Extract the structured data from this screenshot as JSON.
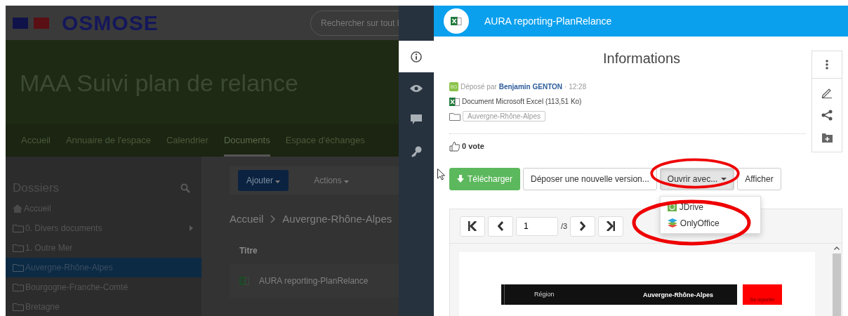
{
  "app": {
    "logo": "OSMOSE",
    "search": "Rechercher sur tout l"
  },
  "space_title": "MAA Suivi plan de relance",
  "nav": [
    {
      "label": "Accueil",
      "selected": false
    },
    {
      "label": "Annuaire de l'espace",
      "selected": false
    },
    {
      "label": "Calendrier",
      "selected": false
    },
    {
      "label": "Documents",
      "selected": true
    },
    {
      "label": "Espace d'échanges",
      "selected": false
    }
  ],
  "sidebar": {
    "title": "Dossiers",
    "items": [
      {
        "label": "Accueil",
        "kind": "home",
        "selected": false,
        "expandable": false
      },
      {
        "label": "0. Divers documents",
        "kind": "folder",
        "selected": false,
        "expandable": true
      },
      {
        "label": "1. Outre Mer",
        "kind": "folder",
        "selected": false,
        "expandable": false
      },
      {
        "label": "Auvergne-Rhône-Alpes",
        "kind": "folder",
        "selected": true,
        "expandable": false
      },
      {
        "label": "Bourgogne-Franche-Comté",
        "kind": "folder",
        "selected": false,
        "expandable": false
      },
      {
        "label": "Bretagne",
        "kind": "folder",
        "selected": false,
        "expandable": false
      }
    ]
  },
  "content": {
    "buttons": [
      {
        "label": "Ajouter",
        "kind": "primary"
      },
      {
        "label": "Actions",
        "kind": "plain"
      }
    ],
    "breadcrumb": [
      "Accueil",
      "Auvergne-Rhône-Alpes"
    ],
    "table": {
      "columns": [
        "Titre"
      ],
      "rows": [
        {
          "title": "AURA reporting-PlanRelance"
        }
      ]
    }
  },
  "side_tabs": [
    {
      "kind": "info",
      "selected": true
    },
    {
      "kind": "preview",
      "selected": false
    },
    {
      "kind": "comments",
      "selected": false
    },
    {
      "kind": "permissions",
      "selected": false
    }
  ],
  "panel": {
    "title": "AURA reporting-PlanRelance",
    "section": "Informations",
    "deposit": {
      "initials": "BG",
      "prefix": "Déposé par",
      "author": "Benjamin GENTON",
      "time": "· 12:28"
    },
    "file_type": "Document Microsoft Excel (113,51 Ko)",
    "folder": "Auvergne-Rhône-Alpes",
    "votes": "0 vote",
    "tools": [
      {
        "kind": "more"
      },
      {
        "kind": "edit"
      },
      {
        "kind": "share"
      },
      {
        "kind": "add-folder"
      }
    ],
    "actions": [
      {
        "label": "Télécharger",
        "kind": "download",
        "expanded": false
      },
      {
        "label": "Déposer une nouvelle version...",
        "kind": "default",
        "expanded": false
      },
      {
        "label": "Ouvrir avec...",
        "kind": "dropdown",
        "expanded": true
      },
      {
        "label": "Afficher",
        "kind": "default",
        "expanded": false
      }
    ],
    "open_with": [
      {
        "label": "JDrive",
        "kind": "jdrive"
      },
      {
        "label": "OnlyOffice",
        "kind": "onlyoffice"
      }
    ],
    "viewer": {
      "page": "1",
      "page_count": "/3",
      "cells": [
        "Région",
        "Auvergne-Rhône-Alpes"
      ],
      "link": "Se reporter"
    }
  }
}
